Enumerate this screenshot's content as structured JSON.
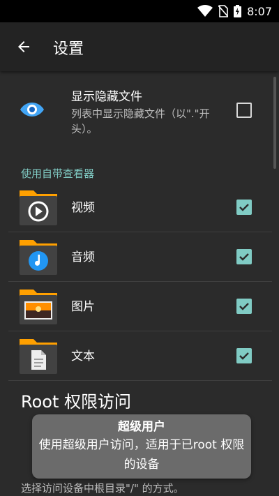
{
  "status_bar": {
    "time": "8:07"
  },
  "app_bar": {
    "title": "设置",
    "back_icon": "arrow-left-icon"
  },
  "hidden_files": {
    "title": "显示隐藏文件",
    "subtitle": "列表中显示隐藏文件（以\".\"开头）。",
    "checked": false,
    "icon": "eye-icon"
  },
  "viewers": {
    "header": "使用自带查看器",
    "items": [
      {
        "label": "视频",
        "icon": "video-folder-icon",
        "checked": true
      },
      {
        "label": "音频",
        "icon": "audio-folder-icon",
        "checked": true
      },
      {
        "label": "图片",
        "icon": "image-folder-icon",
        "checked": true
      },
      {
        "label": "文本",
        "icon": "text-folder-icon",
        "checked": true
      }
    ]
  },
  "root_access": {
    "title": "Root 权限访问",
    "description": "选择访问设备中根目录\"/\" 的方式。"
  },
  "toast": {
    "title": "超级用户",
    "message": "使用超级用户访问，适用于已root 权限的设备"
  },
  "colors": {
    "accent": "#80cbc4",
    "eye": "#42a5f5",
    "folder": "#ffa000",
    "background": "#2b2b2b"
  }
}
